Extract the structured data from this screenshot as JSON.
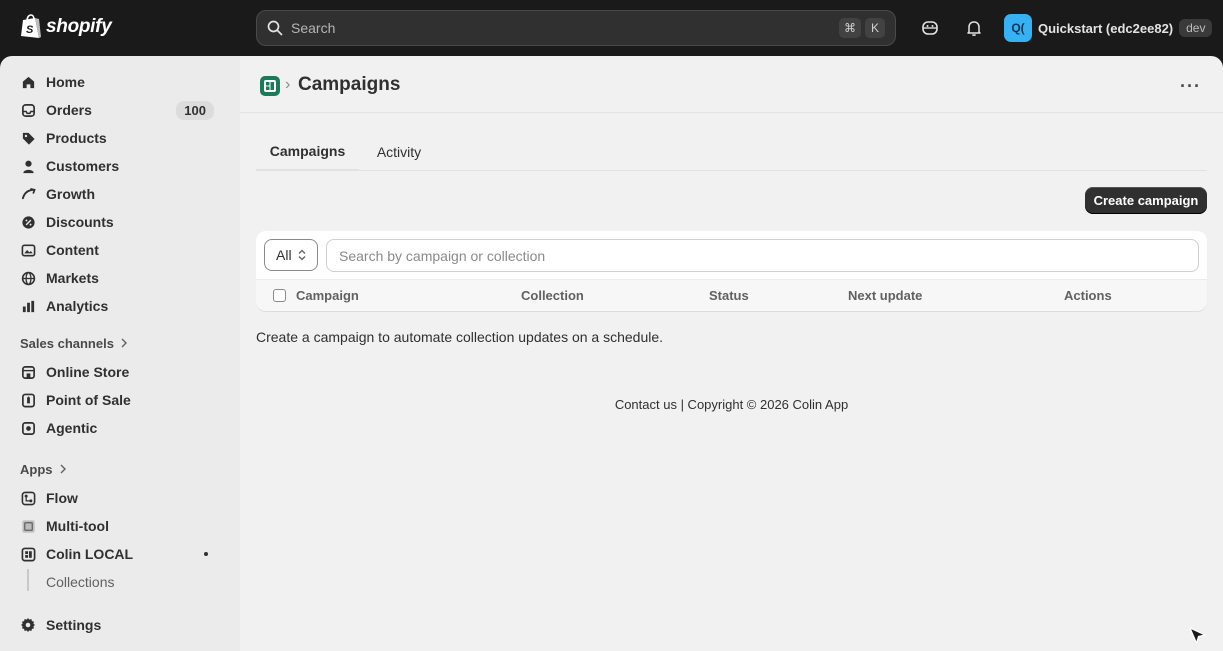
{
  "topbar": {
    "brand": "shopify",
    "search_label": "Search",
    "shortcut": [
      "⌘",
      "K"
    ],
    "store": {
      "avatar_text": "Q(",
      "name": "Quickstart (edc2ee82)",
      "badge": "dev"
    }
  },
  "sidebar": {
    "items": [
      {
        "label": "Home",
        "icon": "home-icon"
      },
      {
        "label": "Orders",
        "icon": "inbox-icon",
        "badge": "100"
      },
      {
        "label": "Products",
        "icon": "tag-icon"
      },
      {
        "label": "Customers",
        "icon": "person-icon"
      },
      {
        "label": "Growth",
        "icon": "growth-icon"
      },
      {
        "label": "Discounts",
        "icon": "discount-icon"
      },
      {
        "label": "Content",
        "icon": "content-icon"
      },
      {
        "label": "Markets",
        "icon": "globe-icon"
      },
      {
        "label": "Analytics",
        "icon": "chart-icon"
      }
    ],
    "sales_channels": {
      "heading": "Sales channels",
      "items": [
        {
          "label": "Online Store",
          "icon": "store-icon"
        },
        {
          "label": "Point of Sale",
          "icon": "pos-icon"
        },
        {
          "label": "Agentic",
          "icon": "agentic-icon"
        }
      ]
    },
    "apps": {
      "heading": "Apps",
      "items": [
        {
          "label": "Flow",
          "icon": "flow-icon"
        },
        {
          "label": "Multi-tool",
          "icon": "multitool-icon"
        },
        {
          "label": "Colin LOCAL",
          "icon": "colin-app-icon"
        }
      ],
      "sub_items": [
        "Collections"
      ]
    },
    "settings_label": "Settings"
  },
  "page": {
    "title": "Campaigns",
    "tabs": [
      "Campaigns",
      "Activity"
    ],
    "create_button": "Create campaign",
    "filter": {
      "selected": "All",
      "search_placeholder": "Search by campaign or collection"
    },
    "table_headers": [
      "Campaign",
      "Collection",
      "Status",
      "Next update",
      "Actions"
    ],
    "empty_message": "Create a campaign to automate collection updates on a schedule.",
    "footer": "Contact us | Copyright © 2026 Colin App"
  },
  "colors": {
    "topbar_bg": "#1a1a1a",
    "sidebar_bg": "#ebebeb",
    "main_bg": "#f1f1f1",
    "primary_button": "#303030",
    "store_avatar": "#36b2f4",
    "app_icon": "#1b7a5a"
  }
}
